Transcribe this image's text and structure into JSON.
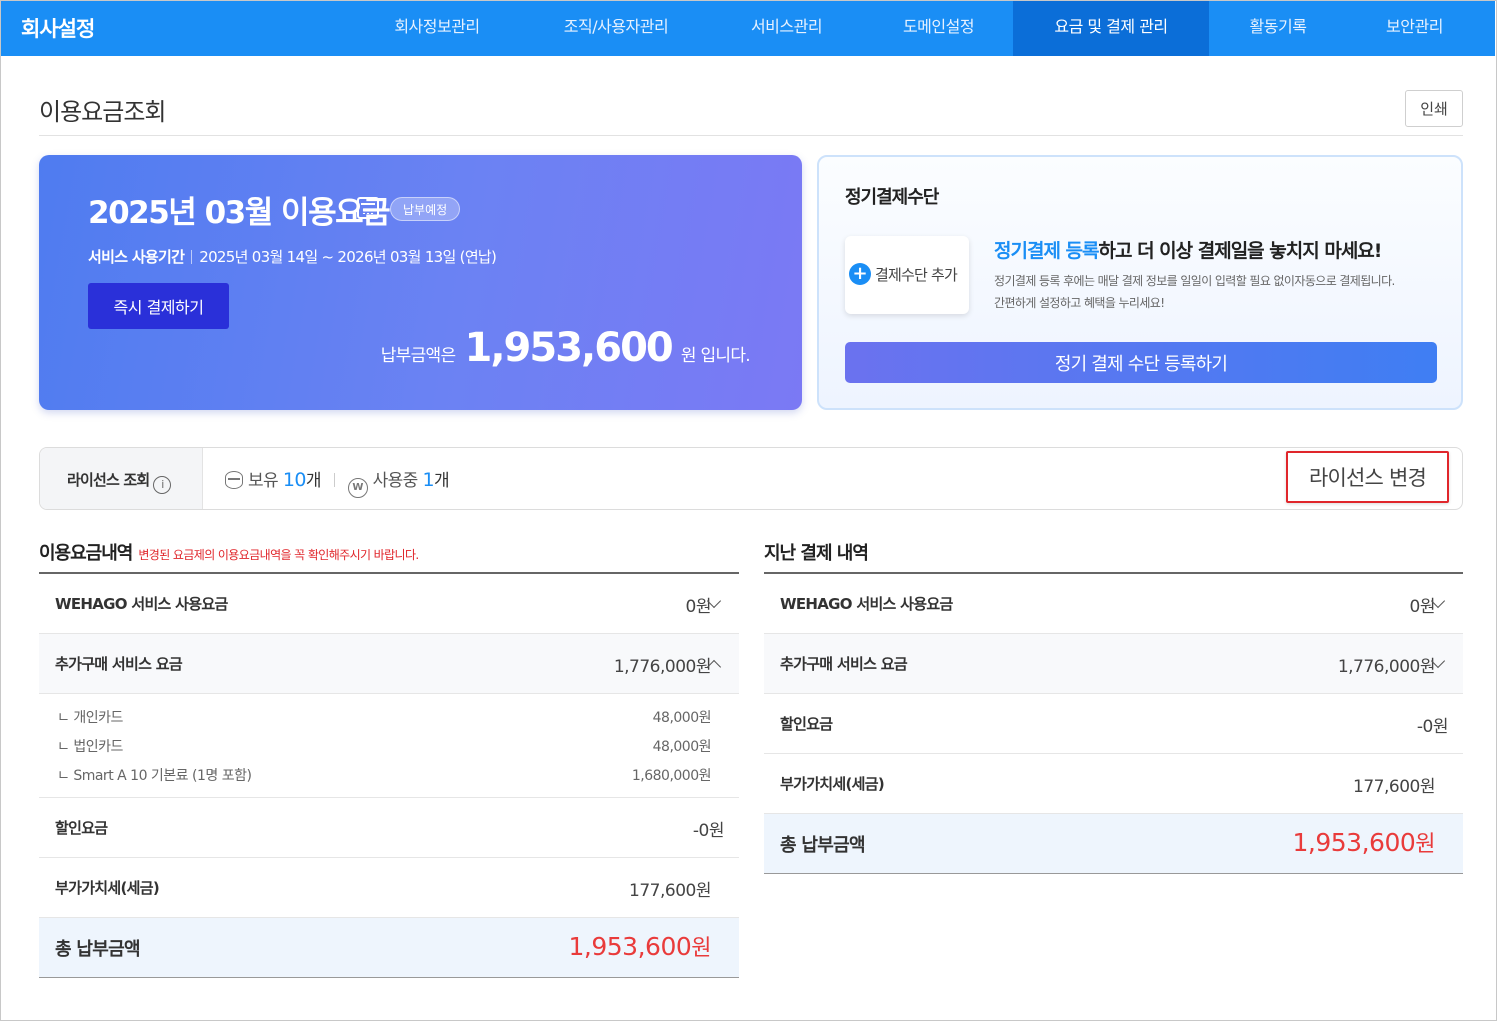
{
  "nav": {
    "brand": "회사설정",
    "items": [
      {
        "label": "회사정보관리"
      },
      {
        "label": "조직/사용자관리"
      },
      {
        "label": "서비스관리"
      },
      {
        "label": "도메인설정"
      },
      {
        "label": "요금 및 결제 관리"
      },
      {
        "label": "활동기록"
      },
      {
        "label": "보안관리"
      }
    ],
    "active_index": 4
  },
  "page": {
    "title": "이용요금조회",
    "print_label": "인쇄"
  },
  "bill": {
    "title": "2025년 03월 이용요금",
    "calendar_icon": "calendar-icon",
    "badge": "납부예정",
    "period_label": "서비스 사용기간",
    "period_value": "2025년 03월 14일 ~ 2026년 03월 13일 (연납)",
    "pay_now_label": "즉시 결제하기",
    "amount_prefix": "납부금액은",
    "amount": "1,953,600",
    "amount_suffix": "원 입니다."
  },
  "recurring": {
    "title": "정기결제수단",
    "add_icon": "plus-circle-icon",
    "add_label": "결제수단 추가",
    "headline_accent": "정기결제 등록",
    "headline_rest": "하고 더 이상 결제일을 놓치지 마세요!",
    "desc_line1": "정기결제 등록 후에는 매달 결제 정보를 일일이 입력할 필요 없이자동으로 결제됩니다.",
    "desc_line2": "간편하게 설정하고 혜택을 누리세요!",
    "register_label": "정기 결제 수단 등록하기",
    "accent_color": "#1a8ef5"
  },
  "license": {
    "label": "라이선스 조회",
    "info_icon": "info-icon",
    "owned_label": "보유",
    "owned_count": "10",
    "owned_unit": "개",
    "inuse_label": "사용중",
    "inuse_count": "1",
    "inuse_unit": "개",
    "change_label": "라이선스 변경"
  },
  "usage": {
    "title": "이용요금내역",
    "note": "변경된 요금제의 이용요금내역을 꼭 확인해주시기 바랍니다.",
    "service_label": "WEHAGO 서비스 사용요금",
    "service_value": "0원",
    "extra_label": "추가구매 서비스 요금",
    "extra_value": "1,776,000원",
    "details": [
      {
        "label": "ㄴ 개인카드",
        "value": "48,000원"
      },
      {
        "label": "ㄴ 법인카드",
        "value": "48,000원"
      },
      {
        "label": "ㄴ Smart A 10 기본료 (1명 포함)",
        "value": "1,680,000원"
      }
    ],
    "discount_label": "할인요금",
    "discount_value": "-0원",
    "vat_label": "부가가치세(세금)",
    "vat_value": "177,600원",
    "total_label": "총 납부금액",
    "total_value": "1,953,600",
    "total_unit": "원"
  },
  "past": {
    "title": "지난 결제 내역",
    "service_label": "WEHAGO 서비스 사용요금",
    "service_value": "0원",
    "extra_label": "추가구매 서비스 요금",
    "extra_value": "1,776,000원",
    "discount_label": "할인요금",
    "discount_value": "-0원",
    "vat_label": "부가가치세(세금)",
    "vat_value": "177,600원",
    "total_label": "총 납부금액",
    "total_value": "1,953,600",
    "total_unit": "원"
  },
  "colors": {
    "nav_bg": "#1a8ef5",
    "nav_active": "#0b6ed8",
    "total_red": "#e93b3b",
    "highlight_red": "#e0262b"
  }
}
